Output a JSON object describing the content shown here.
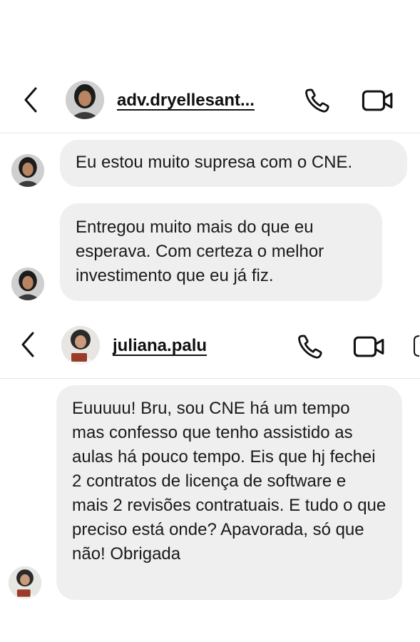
{
  "chat1": {
    "username": "adv.dryellesant...",
    "icons": {
      "back": "chevron-left-icon",
      "call": "phone-icon",
      "video": "video-camera-icon"
    },
    "messages": [
      {
        "text": "Eu estou muito supresa com o CNE."
      },
      {
        "text": "Entregou muito mais do que eu esperava. Com certeza o melhor investimento que eu já fiz."
      }
    ]
  },
  "chat2": {
    "username": "juliana.palu",
    "icons": {
      "back": "chevron-left-icon",
      "call": "phone-icon",
      "video": "video-camera-icon",
      "info": "info-icon"
    },
    "messages": [
      {
        "text": "Euuuuu! Bru, sou CNE há um tempo mas confesso que tenho assistido as aulas há pouco tempo. Eis que hj fechei 2 contratos de licença de software e mais 2 revisões contratuais. E tudo o que preciso está onde? Apavorada, só que não! Obrigada"
      }
    ]
  },
  "colors": {
    "bubble": "#efefef",
    "divider": "#e6e6e6",
    "text": "#111111"
  }
}
